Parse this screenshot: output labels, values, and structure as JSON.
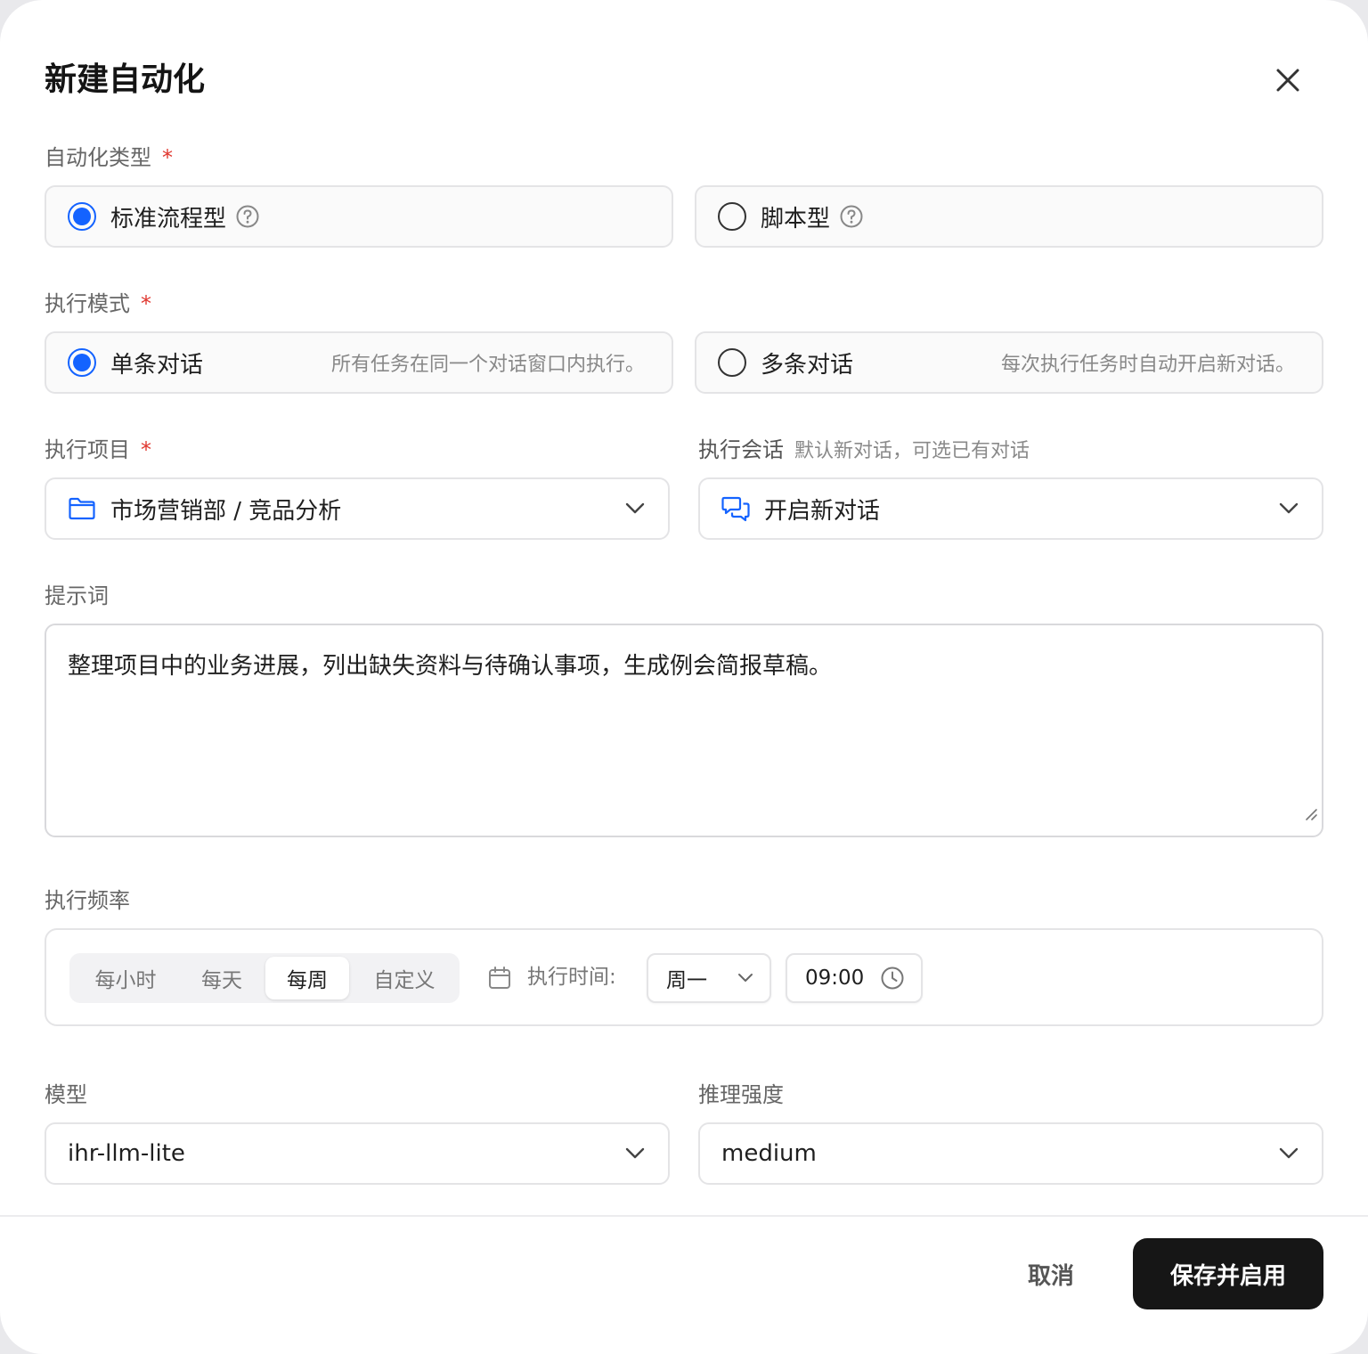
{
  "dialog": {
    "title": "新建自动化"
  },
  "automation_type": {
    "label": "自动化类型",
    "required_mark": "*",
    "options": [
      {
        "label": "标准流程型",
        "selected": true
      },
      {
        "label": "脚本型",
        "selected": false
      }
    ]
  },
  "exec_mode": {
    "label": "执行模式",
    "required_mark": "*",
    "options": [
      {
        "label": "单条对话",
        "desc": "所有任务在同一个对话窗口内执行。",
        "selected": true
      },
      {
        "label": "多条对话",
        "desc": "每次执行任务时自动开启新对话。",
        "selected": false
      }
    ]
  },
  "project": {
    "label": "执行项目",
    "required_mark": "*",
    "value": "市场营销部 / 竞品分析",
    "icon": "folder-icon"
  },
  "session": {
    "label": "执行会话",
    "hint": "默认新对话，可选已有对话",
    "value": "开启新对话",
    "icon": "chat-icon"
  },
  "prompt": {
    "label": "提示词",
    "value": "整理项目中的业务进展，列出缺失资料与待确认事项，生成例会简报草稿。"
  },
  "frequency": {
    "label": "执行频率",
    "tabs": [
      {
        "label": "每小时",
        "selected": false
      },
      {
        "label": "每天",
        "selected": false
      },
      {
        "label": "每周",
        "selected": true
      },
      {
        "label": "自定义",
        "selected": false
      }
    ],
    "time_label": "执行时间:",
    "weekday": "周一",
    "time": "09:00"
  },
  "model": {
    "label": "模型",
    "value": "ihr-llm-lite"
  },
  "reasoning": {
    "label": "推理强度",
    "value": "medium"
  },
  "footer": {
    "cancel_label": "取消",
    "save_label": "保存并启用"
  },
  "colors": {
    "accent": "#1463ff",
    "required": "#e0362e",
    "primary_button": "#161616"
  }
}
